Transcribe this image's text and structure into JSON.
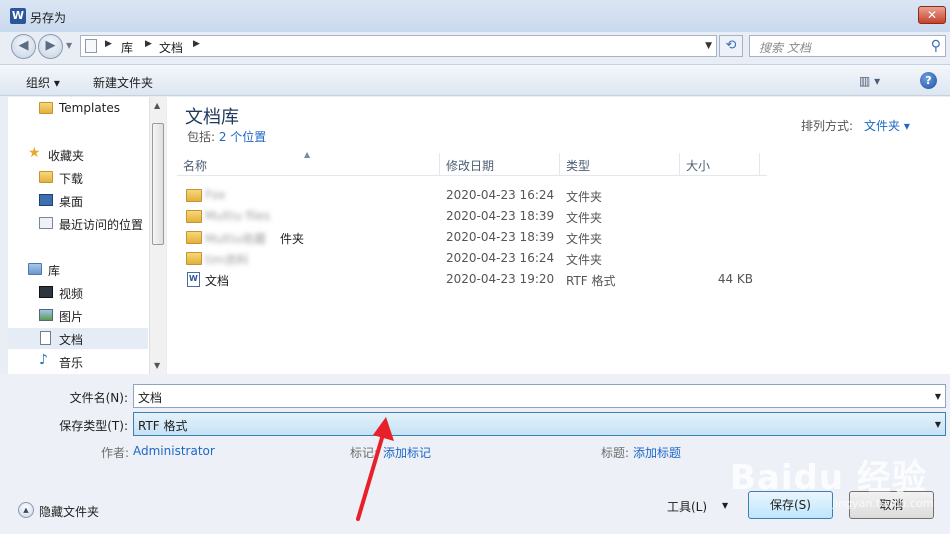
{
  "window": {
    "title": "另存为",
    "app_icon": "word-icon",
    "close": "✕"
  },
  "navbar": {
    "breadcrumbs": [
      "库",
      "文档"
    ],
    "search_placeholder": "搜索 文档"
  },
  "toolbar": {
    "organize": "组织 ▾",
    "new_folder": "新建文件夹",
    "view_icon": "▥ ▾",
    "help": "?"
  },
  "sidebar": {
    "items": [
      {
        "label": "Templates",
        "icon": "folder-icon"
      },
      {
        "label": "收藏夹",
        "icon": "star-icon"
      },
      {
        "label": "下载",
        "icon": "download-folder-icon"
      },
      {
        "label": "桌面",
        "icon": "desktop-icon"
      },
      {
        "label": "最近访问的位置",
        "icon": "recent-places-icon"
      },
      {
        "label": "库",
        "icon": "library-icon"
      },
      {
        "label": "视频",
        "icon": "video-icon"
      },
      {
        "label": "图片",
        "icon": "picture-icon"
      },
      {
        "label": "文档",
        "icon": "document-icon",
        "selected": true
      },
      {
        "label": "音乐",
        "icon": "music-icon"
      }
    ]
  },
  "library": {
    "title": "文档库",
    "includes_prefix": "包括: ",
    "includes_link": "2 个位置",
    "arrange_label": "排列方式:",
    "arrange_value": "文件夹 ▾"
  },
  "columns": {
    "name": "名称",
    "date": "修改日期",
    "type": "类型",
    "size": "大小"
  },
  "files": [
    {
      "name": "Fox",
      "date": "2020-04-23 16:24",
      "type": "文件夹",
      "size": "",
      "blurred": true
    },
    {
      "name": "Multiu files",
      "date": "2020-04-23 18:39",
      "type": "文件夹",
      "size": "",
      "blurred": true
    },
    {
      "name": "Multiu收藏",
      "suffix": "件夹",
      "date": "2020-04-23 18:39",
      "type": "文件夹",
      "size": "",
      "blurred": true
    },
    {
      "name": "tim资料",
      "date": "2020-04-23 16:24",
      "type": "文件夹",
      "size": "",
      "blurred": true
    },
    {
      "name": "文档",
      "date": "2020-04-23 19:20",
      "type": "RTF 格式",
      "size": "44 KB",
      "blurred": false
    }
  ],
  "form": {
    "filename_label": "文件名(N):",
    "filename_value": "文档",
    "filetype_label": "保存类型(T):",
    "filetype_value": "RTF 格式",
    "author_label": "作者:",
    "author_value": "Administrator",
    "tags_label": "标记:",
    "tags_value": "添加标记",
    "title_label": "标题:",
    "title_value": "添加标题"
  },
  "footer": {
    "hide_folders": "隐藏文件夹",
    "tools": "工具(L)",
    "save": "保存(S)",
    "cancel": "取消"
  },
  "watermark": {
    "brand": "Baidu 经验",
    "url": "jingyan.baidu.com"
  },
  "colors": {
    "link": "#1e67c6",
    "title": "#1e395b",
    "annotation": "#e8202a"
  }
}
